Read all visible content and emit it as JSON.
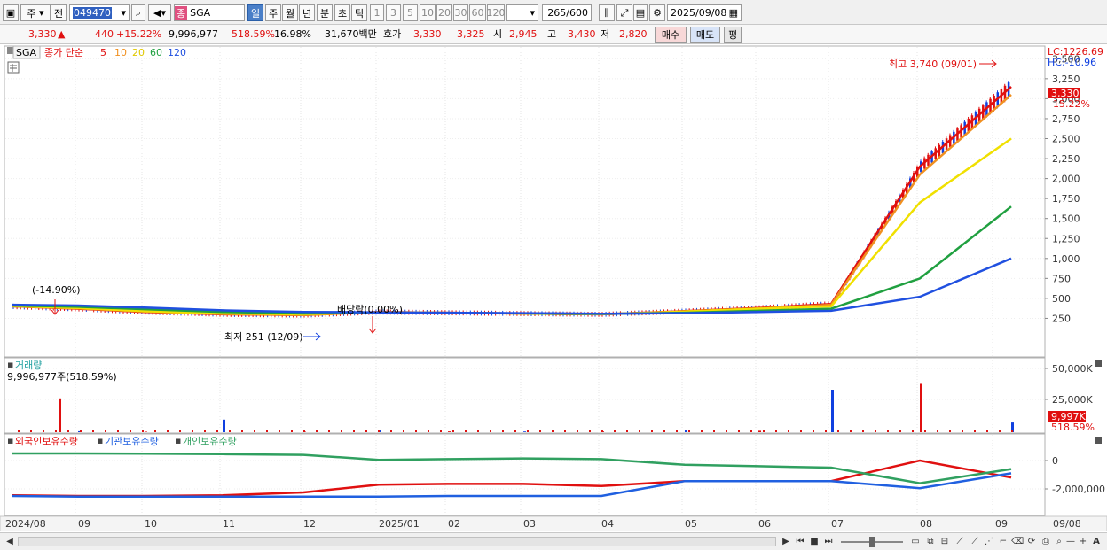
{
  "toolbar": {
    "market": "주",
    "prev_label": "전",
    "code": "049470",
    "name_badge": "종",
    "name": "SGA",
    "period_tabs": [
      "일",
      "주",
      "월",
      "년",
      "분",
      "초",
      "틱"
    ],
    "minute_options": [
      "1",
      "3",
      "5",
      "10",
      "20",
      "30",
      "60",
      "120"
    ],
    "count": "265",
    "count_total": "/600",
    "date": "2025/09/08"
  },
  "info": {
    "price": "3,330",
    "arrow": "▲",
    "change": "440",
    "change_pct": "+15.22%",
    "volume": "9,996,977",
    "volume_ratio": "518.59%",
    "turnover": "16.98%",
    "amount": "31,670백만",
    "quote_label": "호가",
    "ask": "3,330",
    "bid": "3,325",
    "open_label": "시",
    "open": "2,945",
    "high_label": "고",
    "high": "3,430",
    "low_label": "저",
    "low": "2,820",
    "buy_btn": "매수",
    "sell_btn": "매도",
    "eval_btn": "평"
  },
  "legend": {
    "symbol": "SGA",
    "ma_title": "종가 단순",
    "ma_periods": [
      "5",
      "10",
      "20",
      "60",
      "120"
    ]
  },
  "price_panel": {
    "lc_label": "LC:1226.69",
    "hc_label": "HC:-10.96",
    "high_note": "최고 3,740 (09/01)",
    "low_note": "최저 251 (12/09)",
    "pct_note": "(-14.90%)",
    "dividend_note": "배당락(0.00%)",
    "current_price": "3,330",
    "current_pct": "15.22%",
    "y_ticks": [
      "3,500",
      "3,250",
      "3,000",
      "2,750",
      "2,500",
      "2,250",
      "2,000",
      "1,750",
      "1,500",
      "1,250",
      "1,000",
      "750",
      "500",
      "250"
    ]
  },
  "volume_panel": {
    "title": "거래량",
    "value_note": "9,996,977주(518.59%)",
    "y_ticks": [
      "50,000K",
      "25,000K"
    ],
    "current": "9,997K",
    "current_pct": "518.59%"
  },
  "holding_panel": {
    "series_names": [
      "외국인보유수량",
      "기관보유수량",
      "개인보유수량"
    ],
    "y_ticks": [
      "0",
      "-2,000,000"
    ]
  },
  "x_axis": {
    "labels": [
      "2024/08",
      "09",
      "10",
      "11",
      "12",
      "2025/01",
      "02",
      "03",
      "04",
      "05",
      "06",
      "07",
      "08",
      "09",
      "09/08"
    ]
  },
  "colors": {
    "up": "#e01010",
    "down": "#1040e0",
    "ma5": "#e01010",
    "ma10": "#f09020",
    "ma20": "#f0e000",
    "ma60": "#20a040",
    "ma120": "#2050e0",
    "foreign": "#e01010",
    "inst": "#2060e0",
    "retail": "#30a060"
  },
  "chart_data": [
    {
      "type": "line",
      "title": "SGA 종가 단순",
      "ylabel": "",
      "ylim": [
        0,
        3800
      ],
      "x": [
        "2024/08",
        "09",
        "10",
        "11",
        "12",
        "2025/01",
        "02",
        "03",
        "04",
        "05",
        "06",
        "07",
        "08",
        "09"
      ],
      "series": [
        {
          "name": "5",
          "values": [
            400,
            370,
            330,
            300,
            290,
            330,
            320,
            310,
            300,
            340,
            380,
            430,
            2150,
            3150
          ]
        },
        {
          "name": "10",
          "values": [
            400,
            375,
            335,
            305,
            292,
            328,
            320,
            310,
            300,
            338,
            375,
            420,
            2050,
            3050
          ]
        },
        {
          "name": "20",
          "values": [
            405,
            380,
            340,
            310,
            300,
            325,
            318,
            310,
            302,
            335,
            370,
            400,
            1700,
            2500
          ]
        },
        {
          "name": "60",
          "values": [
            410,
            395,
            365,
            330,
            310,
            320,
            318,
            312,
            305,
            320,
            345,
            370,
            750,
            1650
          ]
        },
        {
          "name": "120",
          "values": [
            420,
            410,
            385,
            350,
            330,
            325,
            320,
            315,
            308,
            315,
            330,
            345,
            520,
            1000
          ]
        }
      ]
    },
    {
      "type": "bar",
      "title": "거래량",
      "ylim": [
        0,
        55000
      ],
      "series": [
        {
          "name": "거래량",
          "values": [
            35000,
            1000,
            500,
            13000,
            500,
            2500,
            800,
            700,
            800,
            1800,
            1500,
            44000,
            50000,
            9997
          ]
        }
      ]
    },
    {
      "type": "line",
      "ylim": [
        -2800000,
        500000
      ],
      "series": [
        {
          "name": "외국인보유수량",
          "values": [
            -2450000,
            -2500000,
            -2500000,
            -2450000,
            -2250000,
            -1700000,
            -1650000,
            -1650000,
            -1800000,
            -1450000,
            -1450000,
            -1450000,
            0,
            -1200000
          ]
        },
        {
          "name": "기관보유수량",
          "values": [
            -2500000,
            -2550000,
            -2550000,
            -2550000,
            -2550000,
            -2550000,
            -2500000,
            -2500000,
            -2500000,
            -1450000,
            -1450000,
            -1450000,
            -1950000,
            -900000
          ]
        },
        {
          "name": "개인보유수량",
          "values": [
            500000,
            500000,
            480000,
            450000,
            400000,
            50000,
            100000,
            150000,
            100000,
            -300000,
            -400000,
            -500000,
            -1600000,
            -600000
          ]
        }
      ]
    }
  ]
}
